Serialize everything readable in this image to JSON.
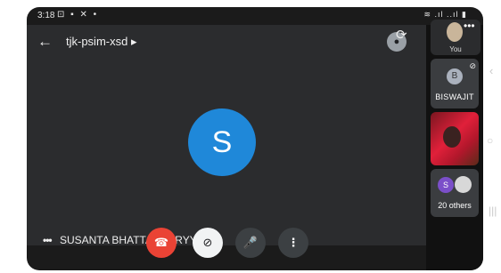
{
  "statusbar": {
    "time": "3:18",
    "left_icons": "⊡ ▪ ✕ •",
    "right_icons": "≋ .ıl ..ıl ▮"
  },
  "topbar": {
    "back_icon": "←",
    "meeting_code": "tjk-psim-xsd ▸",
    "pin_icon": "●"
  },
  "main": {
    "avatar_letter": "S",
    "avatar_color": "#1f88d9"
  },
  "participants": [
    {
      "kind": "self",
      "label": "You"
    },
    {
      "kind": "avatar",
      "letter": "B",
      "label": "BISWAJIT"
    },
    {
      "kind": "video"
    },
    {
      "kind": "group",
      "letter": "S",
      "label": "20 others"
    }
  ],
  "bottom": {
    "more_dots": "•••",
    "presenter_name": "SUSANTA BHATTACHARYY",
    "end_call_icon": "☎",
    "cam_off_icon": "⊘",
    "mic_icon": "🎤",
    "more_icon": "⋮"
  },
  "navbar": {
    "back": "‹",
    "home": "○",
    "recents": "|||"
  },
  "colors": {
    "end_call": "#ea4335",
    "accent_blue": "#1f88d9",
    "purple_avatar": "#7b4fc9",
    "stage": "#2b2c2e"
  }
}
